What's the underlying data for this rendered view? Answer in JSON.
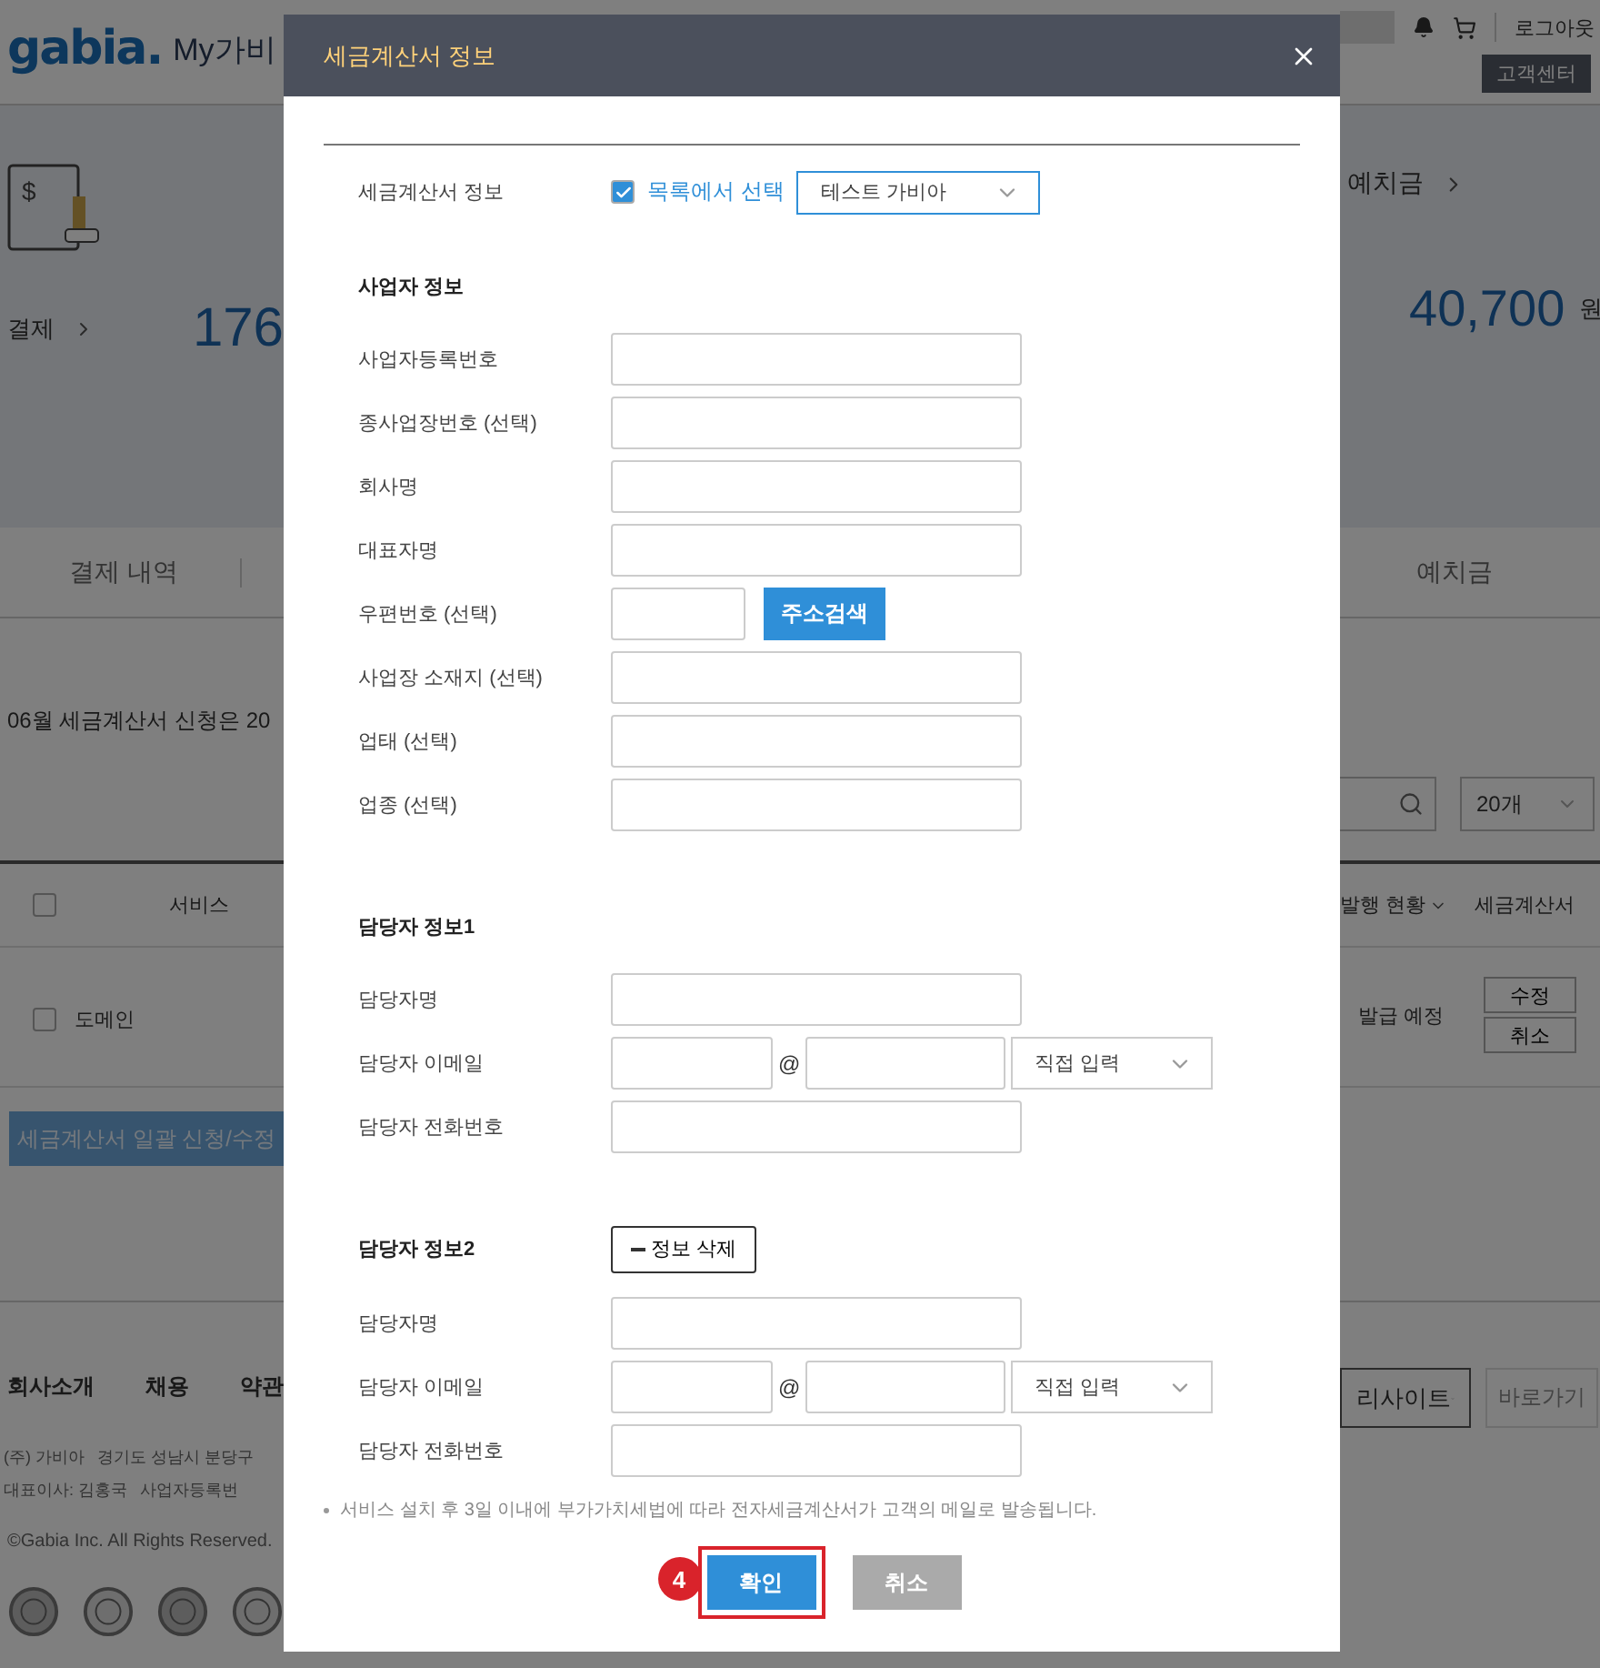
{
  "background": {
    "header": {
      "logo": "gabia.",
      "title": "My가비",
      "logout": "로그아웃",
      "support": "고객센터"
    },
    "summary": {
      "stamp_symbol": "$",
      "payment_label": "결제",
      "payment_amount": "176",
      "deposit_label": "예치금",
      "deposit_amount": "40,700",
      "deposit_unit": "원"
    },
    "tabs": [
      {
        "label": "결제 내역",
        "selected": false
      },
      {
        "label": "예치금",
        "selected": false
      }
    ],
    "notice": "06월 세금계산서 신청은 20",
    "page_size": "20개",
    "table": {
      "columns": [
        "서비스",
        "발행 현황",
        "세금계산서"
      ],
      "header_checked": false,
      "rows": [
        {
          "service": "도메인",
          "status": "발급 예정",
          "actions": [
            "수정",
            "취소"
          ],
          "checked": false
        }
      ]
    },
    "bulk_button": "세금계산서 일괄 신청/수정",
    "footer": {
      "links": [
        "회사소개",
        "채용",
        "약관"
      ],
      "address_lines": [
        [
          "(주) 가비아",
          "경기도 성남시 분당구"
        ],
        [
          "대표이사: 김홍국",
          "사업자등록번"
        ]
      ],
      "copyright": "©Gabia Inc. All Rights Reserved.",
      "family_site": "리사이트",
      "go_button": "바로가기"
    }
  },
  "dialog": {
    "title": "세금계산서 정보",
    "source": {
      "label": "세금계산서 정보",
      "checkbox_label": "목록에서 선택",
      "checked": true,
      "selected_value": "테스트 가비아"
    },
    "sections": [
      {
        "title": "사업자 정보",
        "fields": [
          {
            "label": "사업자등록번호",
            "kind": "text"
          },
          {
            "label": "종사업장번호 (선택)",
            "kind": "text"
          },
          {
            "label": "회사명",
            "kind": "text"
          },
          {
            "label": "대표자명",
            "kind": "text"
          },
          {
            "label": "우편번호 (선택)",
            "kind": "postcode",
            "button": "주소검색"
          },
          {
            "label": "사업장 소재지 (선택)",
            "kind": "text"
          },
          {
            "label": "업태 (선택)",
            "kind": "text"
          },
          {
            "label": "업종 (선택)",
            "kind": "text"
          }
        ]
      },
      {
        "title": "담당자 정보1",
        "fields": [
          {
            "label": "담당자명",
            "kind": "text"
          },
          {
            "label": "담당자 이메일",
            "kind": "email",
            "at": "@",
            "domain_select": "직접 입력"
          },
          {
            "label": "담당자 전화번호",
            "kind": "text"
          }
        ]
      },
      {
        "title": "담당자 정보2",
        "delete_button": "정보 삭제",
        "fields": [
          {
            "label": "담당자명",
            "kind": "text"
          },
          {
            "label": "담당자 이메일",
            "kind": "email",
            "at": "@",
            "domain_select": "직접 입력"
          },
          {
            "label": "담당자 전화번호",
            "kind": "text"
          }
        ]
      }
    ],
    "note": "서비스 설치 후 3일 이내에 부가가치세법에 따라 전자세금계산서가 고객의 메일로 발송됩니다.",
    "buttons": [
      {
        "label": "확인",
        "kind": "primary",
        "highlighted": true,
        "step": "4"
      },
      {
        "label": "취소",
        "kind": "secondary",
        "highlighted": false
      }
    ]
  }
}
